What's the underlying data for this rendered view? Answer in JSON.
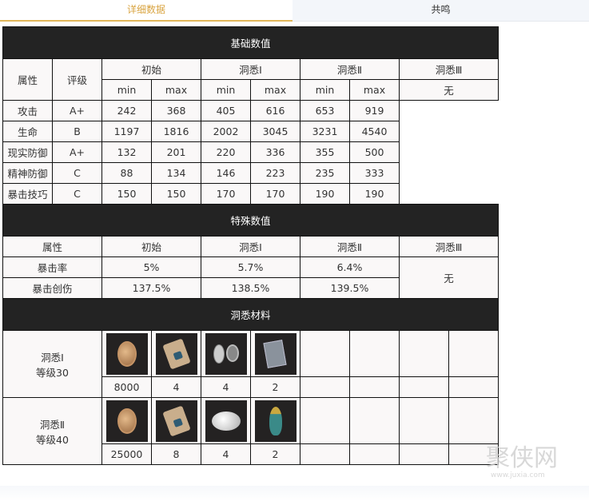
{
  "tabs": [
    {
      "label": "详细数据",
      "active": true
    },
    {
      "label": "共鸣",
      "active": false
    }
  ],
  "base": {
    "title": "基础数值",
    "col_attr": "属性",
    "col_grade": "评级",
    "stages": [
      "初始",
      "洞悉Ⅰ",
      "洞悉Ⅱ",
      "洞悉Ⅲ"
    ],
    "min": "min",
    "max": "max",
    "none": "无",
    "rows": [
      {
        "attr": "攻击",
        "grade": "A+",
        "v": [
          "242",
          "368",
          "405",
          "616",
          "653",
          "919"
        ]
      },
      {
        "attr": "生命",
        "grade": "B",
        "v": [
          "1197",
          "1816",
          "2002",
          "3045",
          "3231",
          "4540"
        ]
      },
      {
        "attr": "现实防御",
        "grade": "A+",
        "v": [
          "132",
          "201",
          "220",
          "336",
          "355",
          "500"
        ]
      },
      {
        "attr": "精神防御",
        "grade": "C",
        "v": [
          "88",
          "134",
          "146",
          "223",
          "235",
          "333"
        ]
      },
      {
        "attr": "暴击技巧",
        "grade": "C",
        "v": [
          "150",
          "150",
          "170",
          "170",
          "190",
          "190"
        ]
      }
    ]
  },
  "special": {
    "title": "特殊数值",
    "headers": [
      "属性",
      "初始",
      "洞悉Ⅰ",
      "洞悉Ⅱ",
      "洞悉Ⅲ"
    ],
    "none": "无",
    "rows": [
      {
        "attr": "暴击率",
        "v": [
          "5%",
          "5.7%",
          "6.4%"
        ]
      },
      {
        "attr": "暴击创伤",
        "v": [
          "137.5%",
          "138.5%",
          "139.5%"
        ]
      }
    ]
  },
  "materials": {
    "title": "洞悉材料",
    "rows": [
      {
        "label1": "洞悉Ⅰ",
        "label2": "等级30",
        "items": [
          {
            "icon": "coin-icon",
            "qty": "8000"
          },
          {
            "icon": "scroll-icon",
            "qty": "4"
          },
          {
            "icon": "tooth-locket-icon",
            "qty": "4"
          },
          {
            "icon": "metal-plates-icon",
            "qty": "2"
          }
        ]
      },
      {
        "label1": "洞悉Ⅱ",
        "label2": "等级40",
        "items": [
          {
            "icon": "coin-icon",
            "qty": "25000"
          },
          {
            "icon": "torn-scroll-icon",
            "qty": "8"
          },
          {
            "icon": "silver-disc-icon",
            "qty": "4"
          },
          {
            "icon": "bird-figurine-icon",
            "qty": "2"
          }
        ]
      }
    ]
  },
  "watermark": {
    "text": "聚侠网",
    "url": "www.juxia.com"
  }
}
